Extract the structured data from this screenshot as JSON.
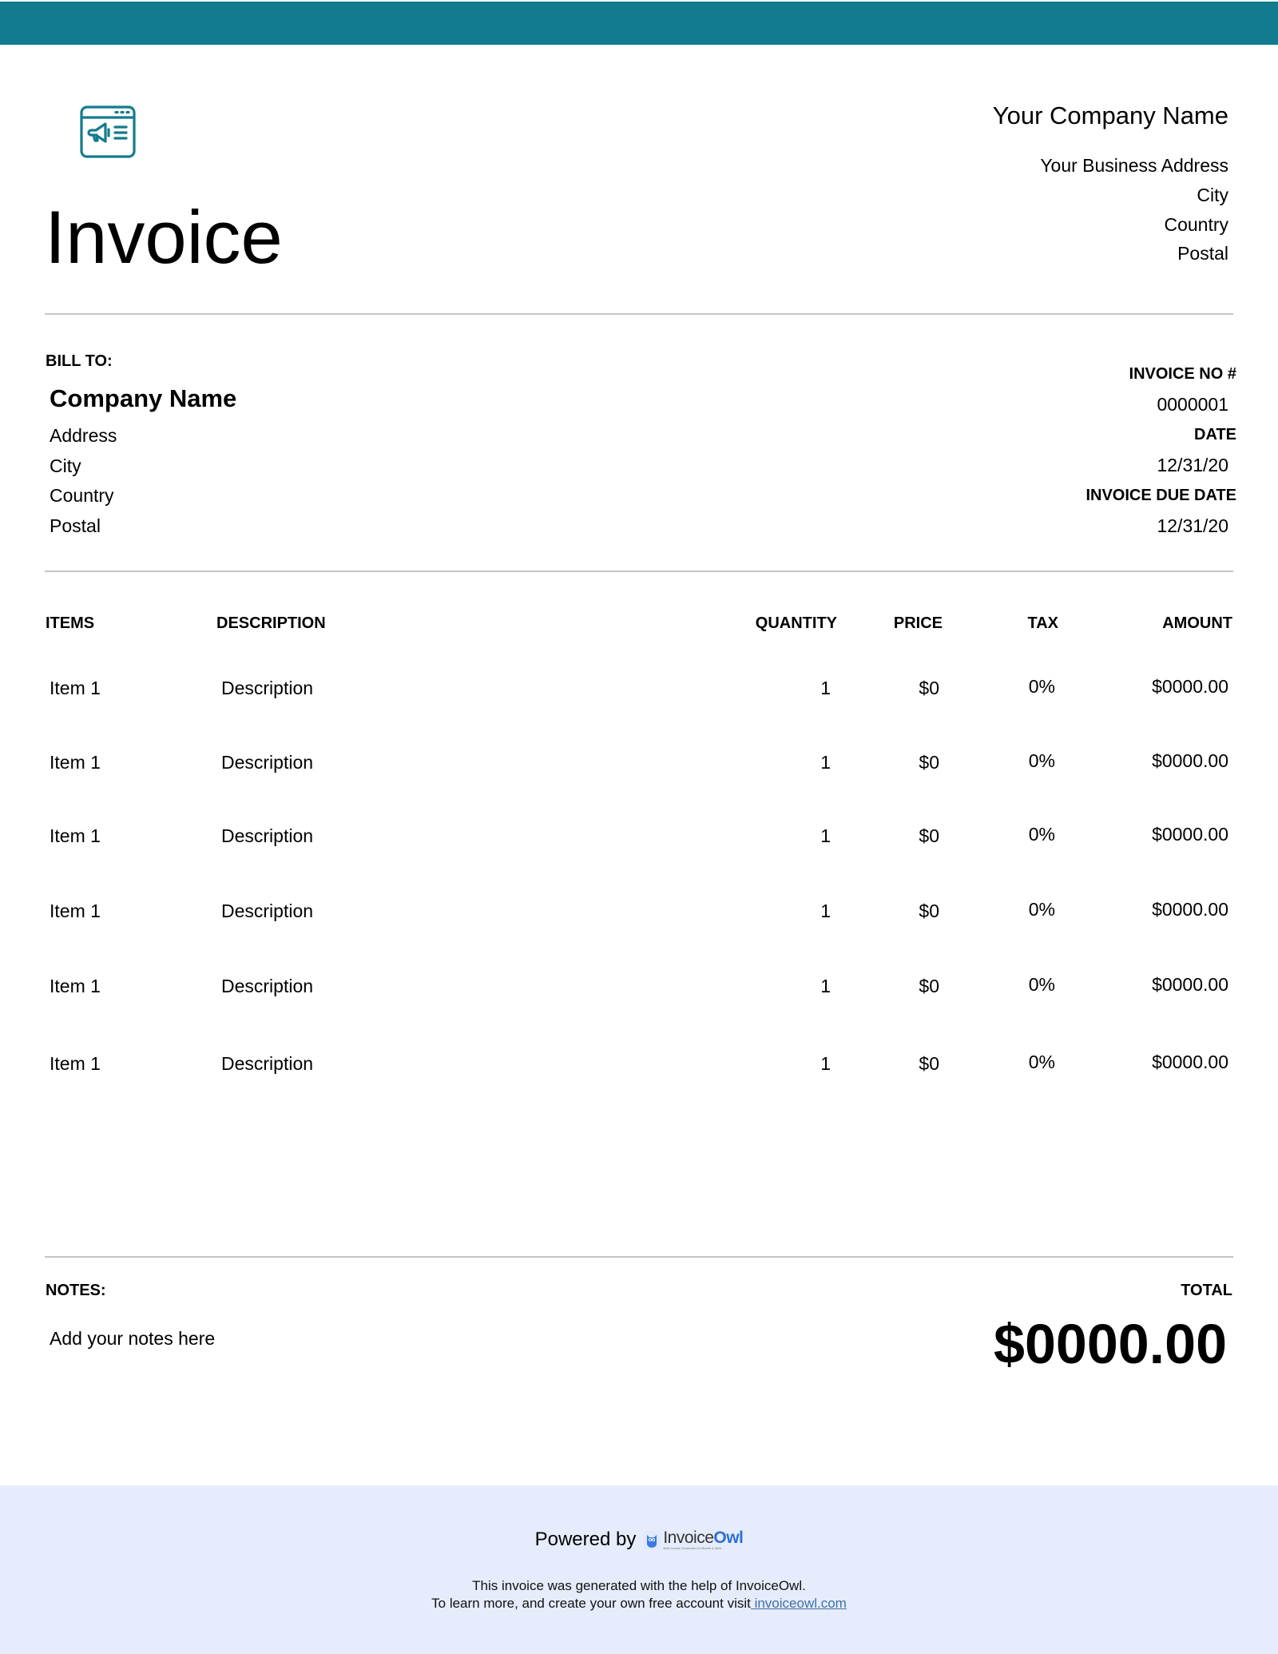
{
  "brand": {
    "accent_color": "#137b8e",
    "footer_bg": "#e6ecfb",
    "logo_icon": "browser-megaphone-icon"
  },
  "header": {
    "title": "Invoice",
    "company_name": "Your Company Name",
    "address_lines": [
      "Your Business Address",
      "City",
      "Country",
      "Postal"
    ]
  },
  "bill_to": {
    "label": "BILL TO:",
    "company_name": "Company Name",
    "address_lines": [
      "Address",
      "City",
      "Country",
      "Postal"
    ]
  },
  "meta": {
    "invoice_no_label": "INVOICE NO #",
    "invoice_no": "0000001",
    "date_label": "DATE",
    "date": "12/31/20",
    "due_date_label": "INVOICE DUE DATE",
    "due_date": "12/31/20"
  },
  "table": {
    "columns": [
      "ITEMS",
      "DESCRIPTION",
      "QUANTITY",
      "PRICE",
      "TAX",
      "AMOUNT"
    ],
    "rows": [
      {
        "item": "Item 1",
        "description": "Description",
        "quantity": "1",
        "price": "$0",
        "tax": "0%",
        "amount": "$0000.00"
      },
      {
        "item": "Item 1",
        "description": "Description",
        "quantity": "1",
        "price": "$0",
        "tax": "0%",
        "amount": "$0000.00"
      },
      {
        "item": "Item 1",
        "description": "Description",
        "quantity": "1",
        "price": "$0",
        "tax": "0%",
        "amount": "$0000.00"
      },
      {
        "item": "Item 1",
        "description": "Description",
        "quantity": "1",
        "price": "$0",
        "tax": "0%",
        "amount": "$0000.00"
      },
      {
        "item": "Item 1",
        "description": "Description",
        "quantity": "1",
        "price": "$0",
        "tax": "0%",
        "amount": "$0000.00"
      },
      {
        "item": "Item 1",
        "description": "Description",
        "quantity": "1",
        "price": "$0",
        "tax": "0%",
        "amount": "$0000.00"
      }
    ]
  },
  "notes": {
    "label": "NOTES:",
    "text": "Add your notes here"
  },
  "total": {
    "label": "TOTAL",
    "value": "$0000.00"
  },
  "footer": {
    "powered_by": "Powered by",
    "logo_name_part1": "Invoice",
    "logo_name_part2": "Owl",
    "logo_tagline": "Best Invoice Generator for Mobile & Web",
    "line1": "This invoice was generated with the help of InvoiceOwl.",
    "line2": "To learn more, and create your own free account visit",
    "link_text": " invoiceowl.com"
  }
}
